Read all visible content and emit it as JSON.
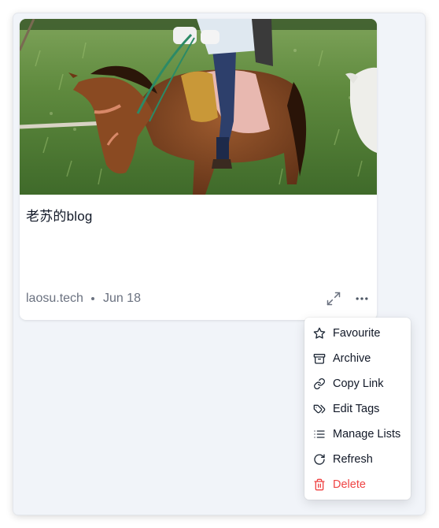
{
  "card": {
    "title": "老苏的blog",
    "domain": "laosu.tech",
    "date": "Jun 18",
    "image_alt": "Person riding a brown horse in a grassy field"
  },
  "actions": {
    "expand_icon": "expand-icon",
    "more_icon": "more-horizontal-icon"
  },
  "menu": {
    "items": [
      {
        "label": "Favourite",
        "icon": "star-icon"
      },
      {
        "label": "Archive",
        "icon": "archive-icon"
      },
      {
        "label": "Copy Link",
        "icon": "link-icon"
      },
      {
        "label": "Edit Tags",
        "icon": "tags-icon"
      },
      {
        "label": "Manage Lists",
        "icon": "list-icon"
      },
      {
        "label": "Refresh",
        "icon": "refresh-icon"
      },
      {
        "label": "Delete",
        "icon": "trash-icon"
      }
    ],
    "danger_color": "#ef4444"
  }
}
